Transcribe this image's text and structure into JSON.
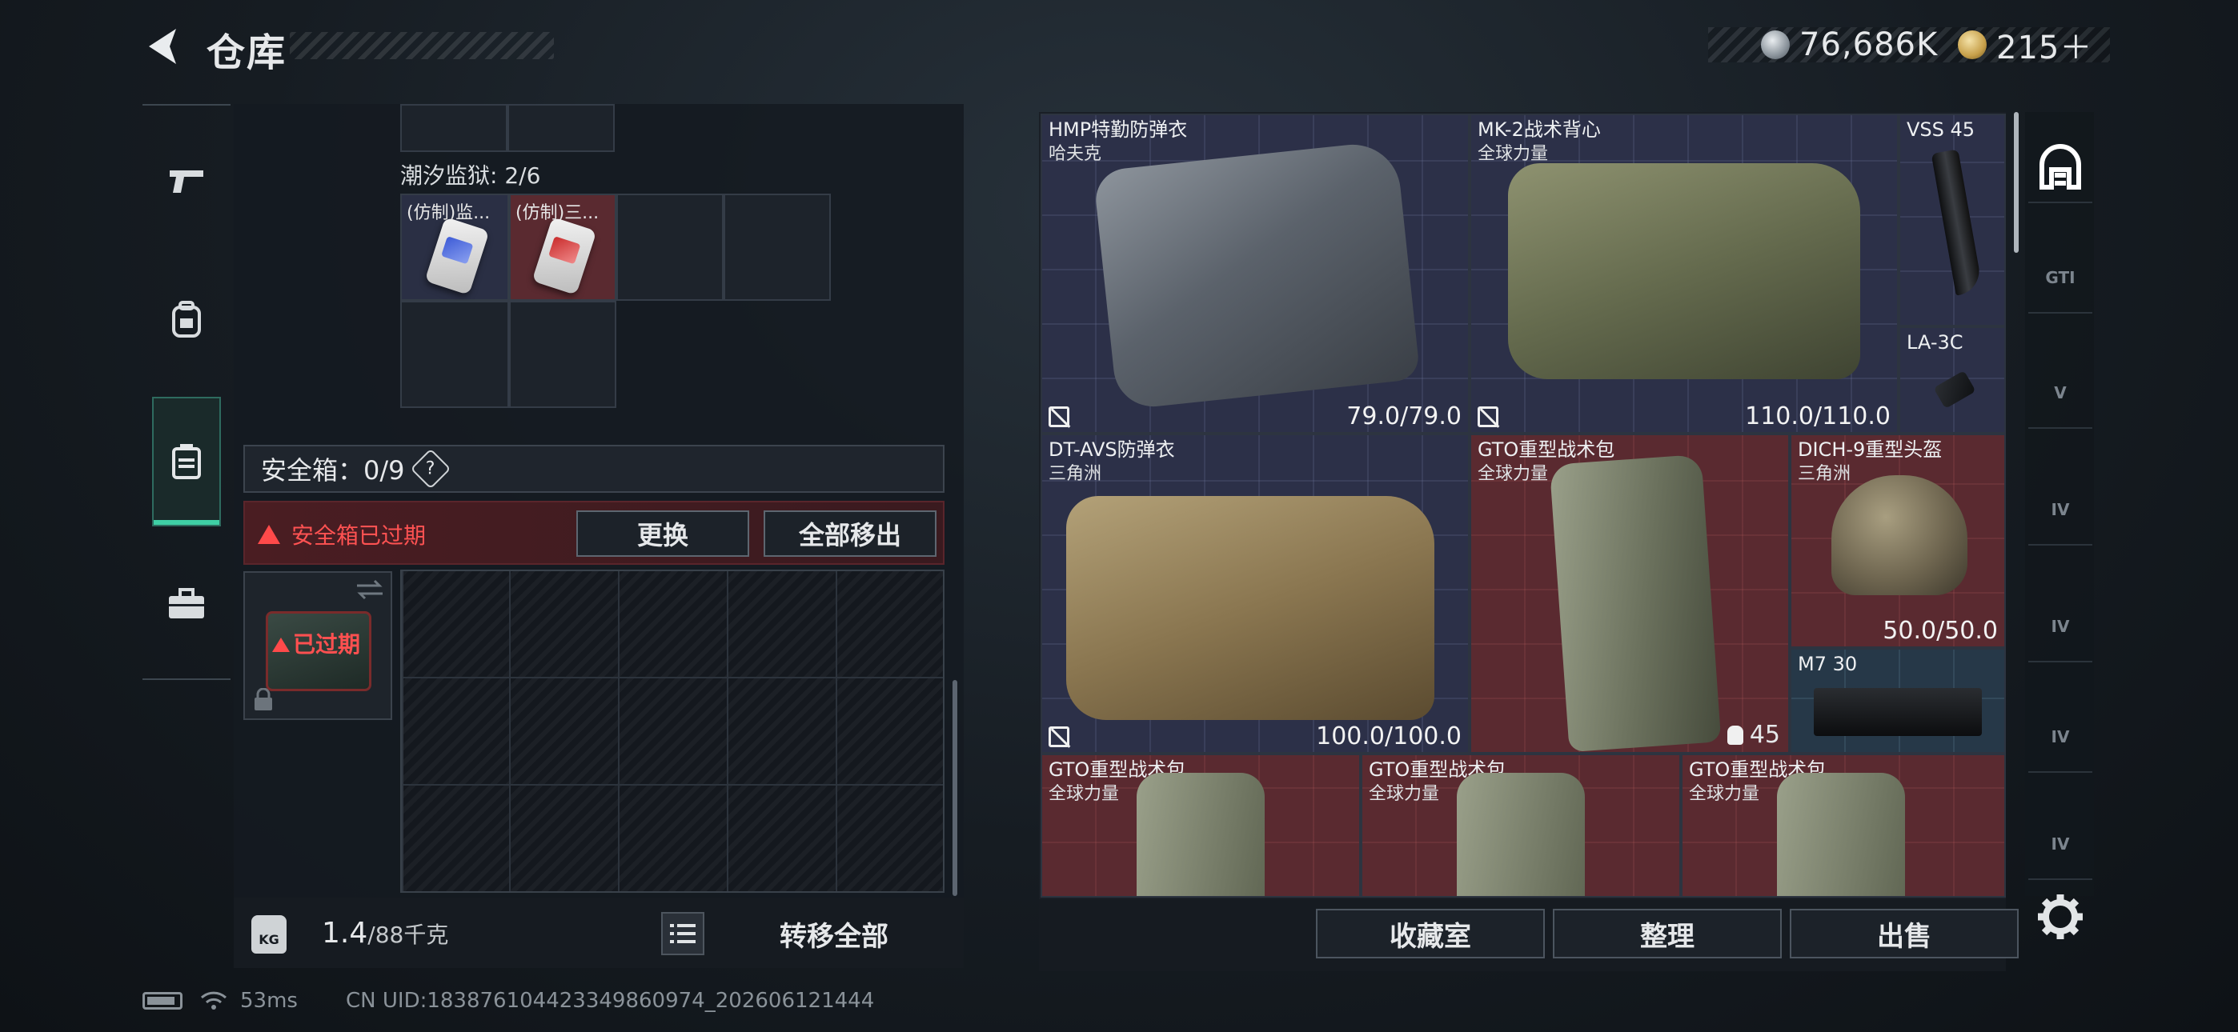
{
  "header": {
    "title": "仓库",
    "currency_silver": "76,686K",
    "currency_gold": "215＋"
  },
  "sidebar": {
    "items": [
      {
        "name": "weapons",
        "icon": "pistol-icon"
      },
      {
        "name": "equipment",
        "icon": "backpack-icon"
      },
      {
        "name": "storage",
        "icon": "container-icon",
        "active": true
      },
      {
        "name": "toolbox",
        "icon": "toolbox-icon"
      }
    ]
  },
  "left_panel": {
    "container_label": "潮汐监狱: 2/6",
    "items": [
      "(仿制)监...",
      "(仿制)三..."
    ],
    "safe_box_label": "安全箱：0/9",
    "help": "?",
    "expired_notice": "安全箱已过期",
    "replace_button": "更换",
    "remove_all_button": "全部移出",
    "case_badge": "已过期",
    "weight_value": "1.4",
    "weight_capacity": "/88千克",
    "kg_label": "KG",
    "transfer_all_button": "转移全部"
  },
  "right_panel": {
    "tiles": [
      {
        "name": "HMP特勤防弹衣",
        "sub": "哈夫克",
        "durability": "79.0/79.0"
      },
      {
        "name": "MK-2战术背心",
        "sub": "全球力量",
        "durability": "110.0/110.0"
      },
      {
        "name": "VSS 45",
        "sub": "",
        "durability": ""
      },
      {
        "name": "LA-3C",
        "sub": "",
        "durability": ""
      },
      {
        "name": "DT-AVS防弹衣",
        "sub": "三角洲",
        "durability": "100.0/100.0"
      },
      {
        "name": "GTO重型战术包",
        "sub": "全球力量",
        "durability": "",
        "count": "45"
      },
      {
        "name": "DICH-9重型头盔",
        "sub": "三角洲",
        "durability": "50.0/50.0"
      },
      {
        "name": "M7 30",
        "sub": "",
        "durability": ""
      },
      {
        "name": "GTO重型战术包",
        "sub": "全球力量",
        "durability": ""
      },
      {
        "name": "GTO重型战术包",
        "sub": "全球力量",
        "durability": ""
      },
      {
        "name": "GTO重型战术包",
        "sub": "全球力量",
        "durability": ""
      }
    ],
    "buttons": {
      "collection": "收藏室",
      "organize": "整理",
      "sell": "出售"
    }
  },
  "right_tabs": [
    "home",
    "GTI",
    "V",
    "IV",
    "IV",
    "IV",
    "IV"
  ],
  "footer": {
    "ping": "53ms",
    "uid": "CN UID:18387610442334986097​4_202606121444"
  },
  "colors": {
    "accent_green": "#3fcfa5",
    "expired_red": "#ff5252",
    "tile_blue": "#2c3048",
    "tile_red": "#5a2a30"
  }
}
